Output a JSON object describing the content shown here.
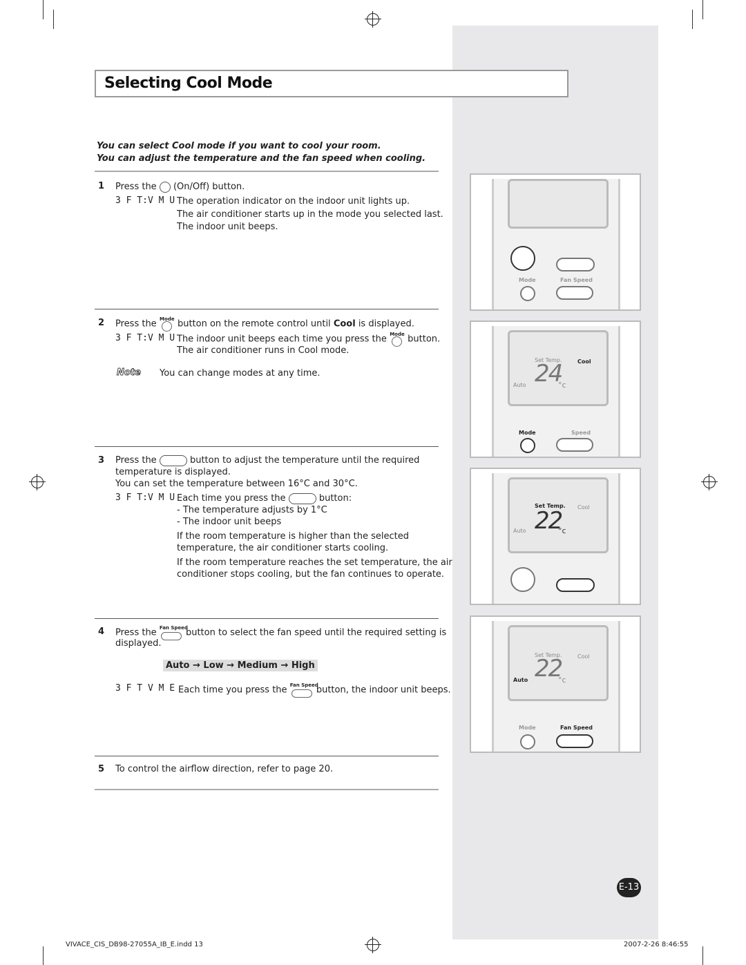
{
  "title": "Selecting Cool Mode",
  "intro": [
    "You can select Cool mode if you want to cool your room.",
    "You can adjust the temperature and the fan speed when cooling."
  ],
  "ref_label": "3 F T:V M U",
  "steps": {
    "s1": {
      "num": "1",
      "pre": "Press the",
      "post": "(On/Off) button.",
      "result": [
        "The operation indicator on the indoor unit lights up.",
        "The air conditioner starts up in the mode you selected last.",
        "The indoor unit beeps."
      ]
    },
    "s2": {
      "num": "2",
      "pre": "Press the",
      "mid": "button on the remote control until",
      "bold": "Cool",
      "post": "is displayed.",
      "result1_pre": "The indoor unit beeps each time you press the",
      "result1_post": "button.",
      "result2": "The air conditioner runs in Cool mode.",
      "note_label": "Note",
      "note": "You can change modes at any time."
    },
    "s3": {
      "num": "3",
      "pre": "Press the",
      "post": "button to adjust the temperature until the required",
      "line2": "temperature is displayed.",
      "line3": "You can set the temperature between 16°C and 30°C.",
      "res_pre": "Each time you press the",
      "res_post": "button:",
      "bullets": [
        "- The temperature adjusts by 1°C",
        "- The indoor unit beeps"
      ],
      "p1": [
        "If the room temperature is higher than the selected",
        "temperature, the air conditioner starts cooling."
      ],
      "p2": [
        "If the room temperature reaches the set temperature, the air",
        "conditioner stops cooling, but the fan continues to operate."
      ]
    },
    "s4": {
      "num": "4",
      "pre": "Press the",
      "post": "button to select the fan speed until the required setting is",
      "line2": "displayed.",
      "sequence": "Auto → Low → Medium → High",
      "ref_label": "3 F T V M E",
      "res_pre": "Each time you press the",
      "res_post": "button, the indoor unit beeps."
    },
    "s5": {
      "num": "5",
      "text": "To control the airflow direction, refer to page 20."
    }
  },
  "icons": {
    "mode": "Mode",
    "fan_speed": "Fan Speed"
  },
  "remotes": {
    "r1": {
      "mode": "Mode",
      "fan": "Fan Speed"
    },
    "r2": {
      "set": "Set Temp.",
      "mode_disp": "Cool",
      "auto": "Auto",
      "temp": "24",
      "unit": "°c",
      "mode": "Mode",
      "fan": "Speed"
    },
    "r3": {
      "set": "Set Temp.",
      "mode_disp": "Cool",
      "auto": "Auto",
      "temp": "22",
      "unit": "°c"
    },
    "r4": {
      "set": "Set Temp.",
      "mode_disp": "Cool",
      "auto": "Auto",
      "temp": "22",
      "unit": "°c",
      "mode": "Mode",
      "fan": "Fan Speed"
    }
  },
  "page_number": "E-13",
  "footer": {
    "file": "VIVACE_CIS_DB98-27055A_IB_E.indd   13",
    "date": "2007-2-26   8:46:55"
  }
}
